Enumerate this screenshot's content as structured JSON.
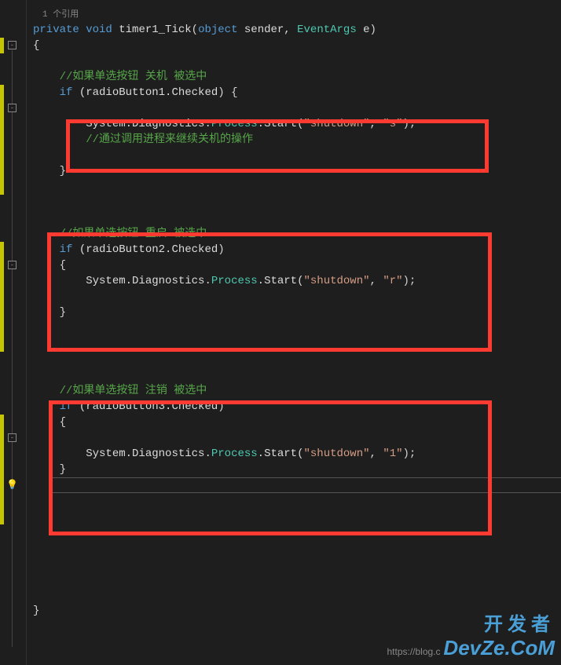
{
  "codelens": "1 个引用",
  "code": {
    "sig": {
      "kw_private": "private",
      "kw_void": "void",
      "method": "timer1_Tick",
      "paren_l": "(",
      "kw_object": "object",
      "p1": " sender, ",
      "type_eventargs": "EventArgs",
      "p2": " e",
      "paren_r": ")"
    },
    "brace_l": "{",
    "brace_r": "}",
    "comment1": "//如果单选按钮 关机 被选中",
    "if1": {
      "kw_if": "if",
      "sp": " (radioButton1.",
      "checked": "Checked",
      "tail": ") {"
    },
    "call1": {
      "p1": "System.",
      "diag": "Diagnostics",
      "dot1": ".",
      "proc": "Process",
      "dot2": ".Start(",
      "s1": "\"shutdown\"",
      "comma": ", ",
      "s2": "\"s\"",
      "tail": ");"
    },
    "comment1b": "//通过调用进程来继续关机的操作",
    "if1_close": "}",
    "comment2": "//如果单选按钮 重启 被选中",
    "if2": {
      "kw_if": "if",
      "sp": " (radioButton2.",
      "checked": "Checked",
      "tail": ")"
    },
    "if2_l": "{",
    "call2": {
      "p1": "System.",
      "diag": "Diagnostics",
      "dot1": ".",
      "proc": "Process",
      "dot2": ".Start(",
      "s1": "\"shutdown\"",
      "comma": ", ",
      "s2": "\"r\"",
      "tail": ");"
    },
    "if2_r": "}",
    "comment3": "//如果单选按钮 注销 被选中",
    "if3": {
      "kw_if": "if",
      "sp": " (radioButton3.",
      "checked": "Checked",
      "tail": ")"
    },
    "if3_l": "{",
    "call3": {
      "p1": "System.",
      "diag": "Diagnostics",
      "dot1": ".",
      "proc": "Process",
      "dot2": ".Start(",
      "s1": "\"shutdown\"",
      "comma": ", ",
      "s2": "\"1\"",
      "tail": ");"
    },
    "if3_r": "}"
  },
  "watermark": {
    "url": "https://blog.c",
    "cn": "开发者",
    "en": "DevZe.CoM"
  },
  "glyphs": {
    "minus": "-",
    "bulb": "💡"
  }
}
